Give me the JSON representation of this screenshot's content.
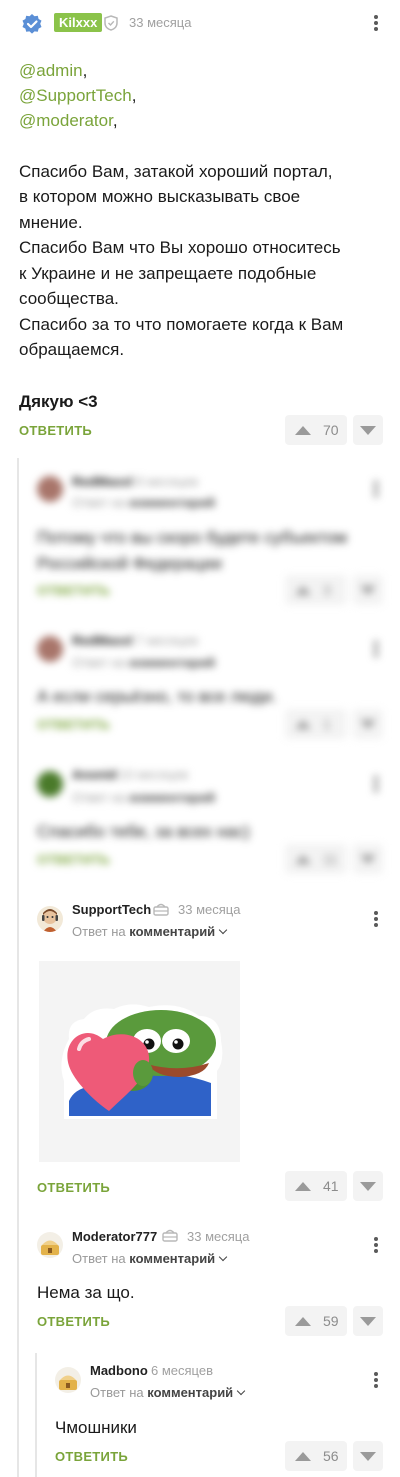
{
  "main_comment": {
    "author": "Kilxxx",
    "time": "33 месяца",
    "mentions": [
      "@admin",
      "@SupportTech",
      "@moderator"
    ],
    "body_lines": [
      "Спасибо Вам, затакой хороший портал,",
      "в котором можно высказывать свое",
      "мнение.",
      "Спасибо Вам что Вы хорошо относитесь",
      "к Украине и не запрещаете подобные",
      "сообщества.",
      "Спасибо за то что помогаете когда к Вам",
      "обращаемся."
    ],
    "signoff": "Дякую <3",
    "reply_label": "ОТВЕТИТЬ",
    "votes": "70"
  },
  "blurred_comments": [
    {
      "author": "RedMaxxl",
      "time": "8 месяцев",
      "reply_to": "Ответ на",
      "reply_target": "комментарий",
      "body": "Потому что вы скоро будете субъектом Российской Федерации",
      "reply_label": "ОТВЕТИТЬ",
      "votes": "3"
    },
    {
      "author": "RedMaxxl",
      "time": "7 месяцев",
      "reply_to": "Ответ на",
      "reply_target": "комментарий",
      "body": "А если серьёзно, то все люди.",
      "reply_label": "ОТВЕТИТЬ",
      "votes": "1"
    },
    {
      "author": "Anonid",
      "time": "10 месяцев",
      "reply_to": "Ответ на",
      "reply_target": "комментарий",
      "body": "Спасибо тебе, за всех нас)",
      "reply_label": "ОТВЕТИТЬ",
      "votes": "11"
    }
  ],
  "support_comment": {
    "author": "SupportTech",
    "time": "33 месяца",
    "reply_to": "Ответ на",
    "reply_target": "комментарий",
    "reply_label": "ОТВЕТИТЬ",
    "votes": "41"
  },
  "moderator_comment": {
    "author": "Moderator777",
    "time": "33 месяца",
    "reply_to": "Ответ на",
    "reply_target": "комментарий",
    "body": "Нема за що.",
    "reply_label": "ОТВЕТИТЬ",
    "votes": "59"
  },
  "madbono_comment": {
    "author": "Madbono",
    "time": "6 месяцев",
    "reply_to": "Ответ на",
    "reply_target": "комментарий",
    "body": "Чмошники",
    "reply_label": "ОТВЕТИТЬ",
    "votes": "56"
  },
  "colors": {
    "accent_green": "#7aa43a",
    "author_badge_green": "#8bc34a",
    "muted": "#a0a0a0",
    "vote_bg": "#f3f3f3"
  },
  "icons": [
    "verified-badge-icon",
    "shield-icon",
    "kebab-menu-icon",
    "upvote-icon",
    "downvote-icon",
    "chevron-down-icon",
    "moderator-badge-icon"
  ]
}
